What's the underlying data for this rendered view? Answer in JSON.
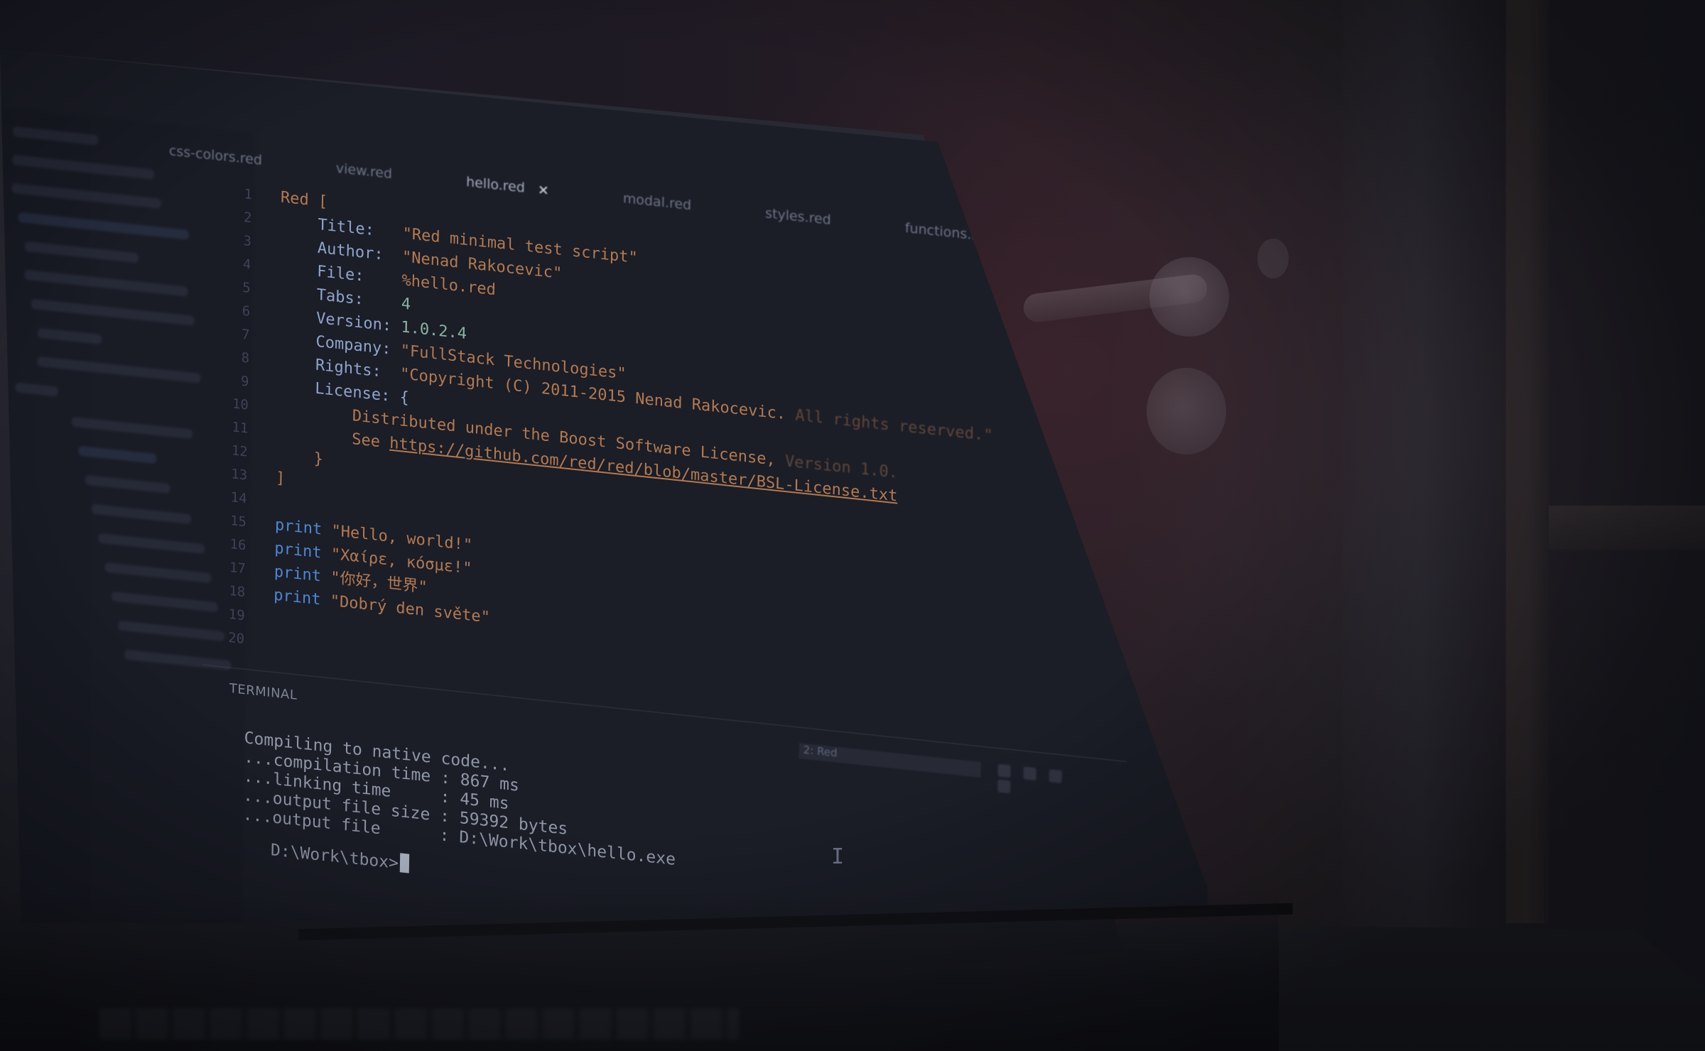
{
  "tabs": [
    {
      "label": "css-colors.red"
    },
    {
      "label": "view.red"
    },
    {
      "label": "hello.red",
      "close": "×"
    },
    {
      "label": "modal.red"
    },
    {
      "label": "styles.red"
    },
    {
      "label": "functions.red"
    }
  ],
  "editor": {
    "lines": [
      {
        "n": "1",
        "a": "Red [",
        "b": "",
        "c": ""
      },
      {
        "n": "2",
        "a": "    Title:   ",
        "b": "\"Red minimal test script\"",
        "c": ""
      },
      {
        "n": "3",
        "a": "    Author:  ",
        "b": "\"Nenad Rakocevic\"",
        "c": ""
      },
      {
        "n": "4",
        "a": "    File:    ",
        "b": "%hello.red",
        "c": ""
      },
      {
        "n": "5",
        "a": "    Tabs:    ",
        "b": "4",
        "c": ""
      },
      {
        "n": "6",
        "a": "    Version: ",
        "b": "1.0.2.4",
        "c": ""
      },
      {
        "n": "7",
        "a": "    Company: ",
        "b": "\"FullStack Technologies\"",
        "c": ""
      },
      {
        "n": "8",
        "a": "    Rights:  ",
        "b": "\"Copyright (C) 2011-2015 Nenad Rakocevic.",
        "c": " All rights reserved.\""
      },
      {
        "n": "9",
        "a": "    License: {",
        "b": "",
        "c": ""
      },
      {
        "n": "10",
        "a": "        ",
        "b": "Distributed under the Boost Software License,",
        "c": " Version 1.0."
      },
      {
        "n": "11",
        "a": "        ",
        "b": "See ",
        "c": "https://github.com/red/red/blob/master/BSL-License.txt"
      },
      {
        "n": "12",
        "a": "    }",
        "b": "",
        "c": ""
      },
      {
        "n": "13",
        "a": "]",
        "b": "",
        "c": ""
      },
      {
        "n": "14",
        "a": "",
        "b": "",
        "c": ""
      },
      {
        "n": "15",
        "a": "print ",
        "b": "\"Hello, world!\"",
        "c": ""
      },
      {
        "n": "16",
        "a": "print ",
        "b": "\"Χαίρε, κόσμε!\"",
        "c": ""
      },
      {
        "n": "17",
        "a": "print ",
        "b": "\"你好，世界\"",
        "c": ""
      },
      {
        "n": "18",
        "a": "print ",
        "b": "\"Dobrý den světe\"",
        "c": ""
      },
      {
        "n": "19",
        "a": "",
        "b": "",
        "c": ""
      },
      {
        "n": "20",
        "a": "",
        "b": "",
        "c": ""
      }
    ]
  },
  "terminal": {
    "label": "TERMINAL",
    "selected_shell": "2: Red",
    "output": [
      "Compiling to native code...",
      "...compilation time : 867 ms",
      "...linking time     : 45 ms",
      "...output file size : 59392 bytes",
      "...output file      : D:\\Work\\tbox\\hello.exe"
    ],
    "prompt": "D:\\Work\\tbox>"
  },
  "colors": {
    "keyword": "#4f86d3",
    "string": "#b27a52",
    "field": "#8fa4cc",
    "background": "#1b1d27"
  }
}
